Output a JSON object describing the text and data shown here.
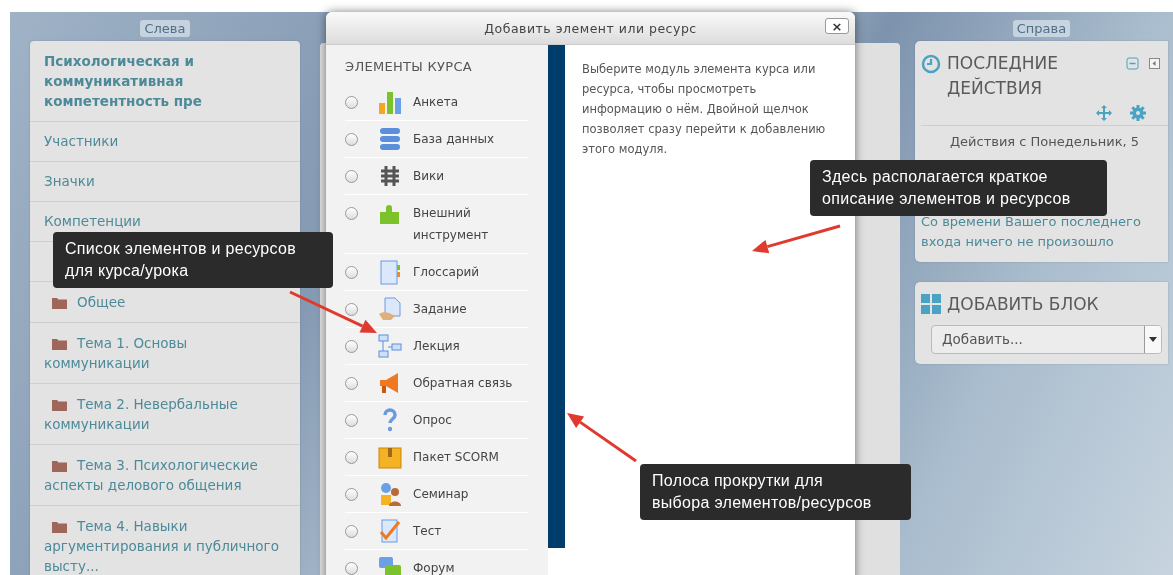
{
  "left_region": {
    "label": "Слева",
    "course_title": "Психологическая и коммуникативная компетентность пре",
    "nav_items": [
      {
        "label": "Участники"
      },
      {
        "label": "Значки"
      },
      {
        "label": "Компетенции"
      }
    ],
    "sections": [
      {
        "label": "Общее"
      },
      {
        "label": "Тема 1. Основы коммуникации"
      },
      {
        "label": "Тема 2. Невербальные коммуникации"
      },
      {
        "label": "Тема 3. Психологические аспекты делового общения"
      },
      {
        "label": "Тема 4. Навыки аргументирования и публичного высту..."
      }
    ]
  },
  "dialog": {
    "title": "Добавить элемент или ресурс",
    "close": "×",
    "section_heading": "ЭЛЕМЕНТЫ КУРСА",
    "modules": [
      {
        "kind": "survey",
        "label": "Анкета",
        "selected": false
      },
      {
        "kind": "database",
        "label": "База данных",
        "selected": false
      },
      {
        "kind": "wiki",
        "label": "Вики",
        "selected": false
      },
      {
        "kind": "lti",
        "label": "Внешний инструмент",
        "selected": false
      },
      {
        "kind": "glossary",
        "label": "Глоссарий",
        "selected": false
      },
      {
        "kind": "assignment",
        "label": "Задание",
        "selected": false
      },
      {
        "kind": "lesson",
        "label": "Лекция",
        "selected": false
      },
      {
        "kind": "feedback",
        "label": "Обратная связь",
        "selected": false
      },
      {
        "kind": "choice",
        "label": "Опрос",
        "selected": false
      },
      {
        "kind": "scorm",
        "label": "Пакет SCORM",
        "selected": false
      },
      {
        "kind": "workshop",
        "label": "Семинар",
        "selected": false
      },
      {
        "kind": "quiz",
        "label": "Тест",
        "selected": false
      },
      {
        "kind": "forum",
        "label": "Форум",
        "selected": false
      }
    ],
    "description": "Выберите модуль элемента курса или ресурса, чтобы просмотреть информацию о нём. Двойной щелчок позволяет сразу перейти к добавлению этого модуля."
  },
  "right_region": {
    "label": "Справа",
    "recent_activity": {
      "title": "ПОСЛЕДНИЕ ДЕЙСТВИЯ",
      "since": "Действия с Понедельник, 5",
      "message": "Со времени Вашего последнего входа ничего не произошло"
    },
    "add_block": {
      "title": "ДОБАВИТЬ БЛОК",
      "select_value": "Добавить..."
    }
  },
  "callouts": [
    {
      "text": "Список элементов и ресурсов для курса/урока"
    },
    {
      "text": "Здесь располагается краткое описание элементов и ресурсов"
    },
    {
      "text": "Полоса прокрутки для выбора элементов/ресурсов"
    }
  ]
}
